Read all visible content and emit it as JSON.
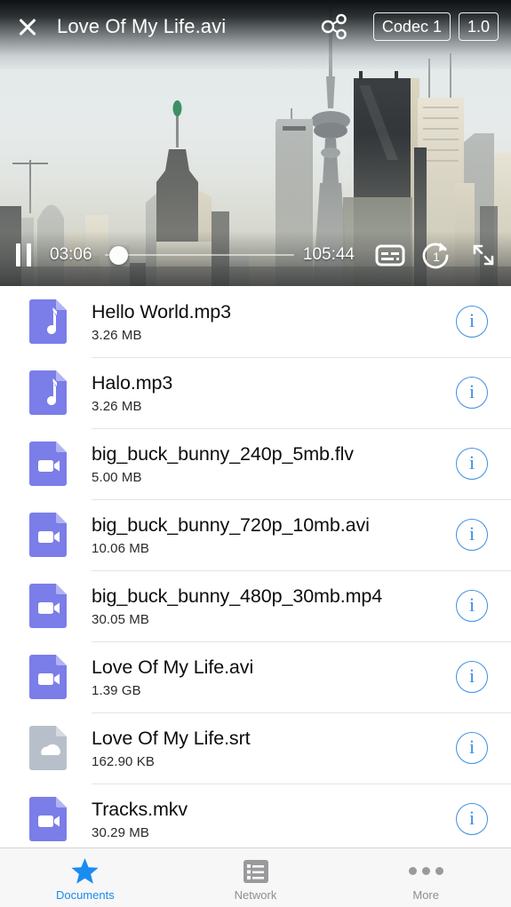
{
  "player": {
    "close_icon": "close-icon",
    "title": "Love Of My Life.avi",
    "share_icon": "share-nodes-icon",
    "codec_label": "Codec 1",
    "speed_label": "1.0",
    "pause_icon": "pause-icon",
    "current_time": "03:06",
    "total_time": "105:44",
    "progress_percent": 3,
    "subtitle_icon": "subtitles-icon",
    "repeat_icon": "repeat-one-icon",
    "fullscreen_icon": "fullscreen-icon",
    "poster_alt": "city-skyline-frame"
  },
  "files": [
    {
      "name": "Hello World.mp3",
      "size": "3.26 MB",
      "type": "audio",
      "info_icon": "info-icon"
    },
    {
      "name": "Halo.mp3",
      "size": "3.26 MB",
      "type": "audio",
      "info_icon": "info-icon"
    },
    {
      "name": "big_buck_bunny_240p_5mb.flv",
      "size": "5.00 MB",
      "type": "video",
      "info_icon": "info-icon"
    },
    {
      "name": "big_buck_bunny_720p_10mb.avi",
      "size": "10.06 MB",
      "type": "video",
      "info_icon": "info-icon"
    },
    {
      "name": "big_buck_bunny_480p_30mb.mp4",
      "size": "30.05 MB",
      "type": "video",
      "info_icon": "info-icon"
    },
    {
      "name": "Love Of My Life.avi",
      "size": "1.39 GB",
      "type": "video",
      "info_icon": "info-icon"
    },
    {
      "name": "Love Of My Life.srt",
      "size": "162.90 KB",
      "type": "cloud",
      "info_icon": "info-icon"
    },
    {
      "name": "Tracks.mkv",
      "size": "30.29 MB",
      "type": "video",
      "info_icon": "info-icon"
    }
  ],
  "tabs": [
    {
      "label": "Documents",
      "icon": "star-icon",
      "active": true
    },
    {
      "label": "Network",
      "icon": "list-icon",
      "active": false
    },
    {
      "label": "More",
      "icon": "ellipsis-icon",
      "active": false
    }
  ],
  "colors": {
    "accent_blue": "#1a8cf0",
    "info_blue": "#3d8fe0",
    "file_purple": "#7b7de8",
    "file_gray": "#b7c0ca",
    "tabbar_bg": "#f7f7f7",
    "inactive_gray": "#8e8e92"
  }
}
